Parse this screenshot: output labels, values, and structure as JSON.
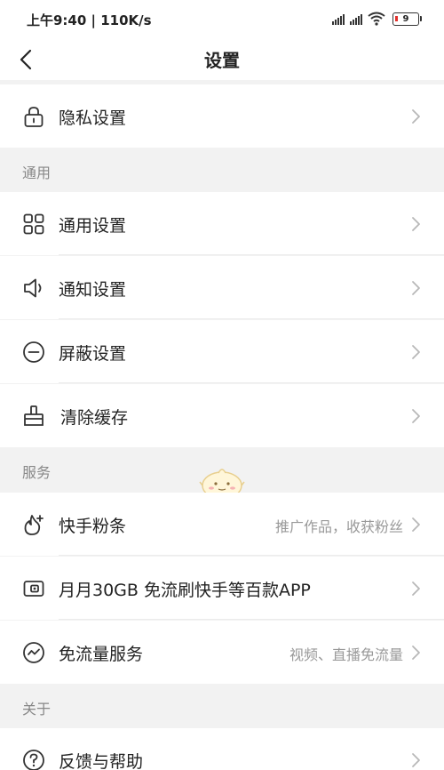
{
  "status_bar": {
    "time_speed": "上午9:40 | 110K/s",
    "battery_level": "9",
    "battery_color": "#e2302b",
    "icons": [
      "signal-icon",
      "signal-icon",
      "wifi-icon",
      "battery-icon"
    ]
  },
  "nav": {
    "title": "设置",
    "back_icon": "chevron-left-icon"
  },
  "rows": {
    "privacy": {
      "label": "隐私设置",
      "icon": "lock-icon"
    },
    "general": {
      "label": "通用设置",
      "icon": "grid-icon"
    },
    "notifications": {
      "label": "通知设置",
      "icon": "speaker-icon"
    },
    "blocking": {
      "label": "屏蔽设置",
      "icon": "minus-circle-icon"
    },
    "clear_cache": {
      "label": "清除缓存",
      "icon": "broom-icon"
    },
    "fans": {
      "label": "快手粉条",
      "hint": "推广作品，收获粉丝",
      "icon": "flame-plus-icon"
    },
    "data_card": {
      "label": "月月30GB 免流刷快手等百款APP",
      "icon": "sim-card-icon"
    },
    "free_data": {
      "label": "免流量服务",
      "hint": "视频、直播免流量",
      "icon": "wave-circle-icon"
    },
    "feedback": {
      "label": "反馈与帮助",
      "icon": "question-circle-icon"
    }
  },
  "sections": {
    "general": "通用",
    "services": "服务",
    "about": "关于"
  },
  "colors": {
    "background": "#f2f2f2",
    "row": "#ffffff",
    "text": "#222222",
    "secondary_text": "#999999",
    "chevron": "#b8b8b8"
  }
}
